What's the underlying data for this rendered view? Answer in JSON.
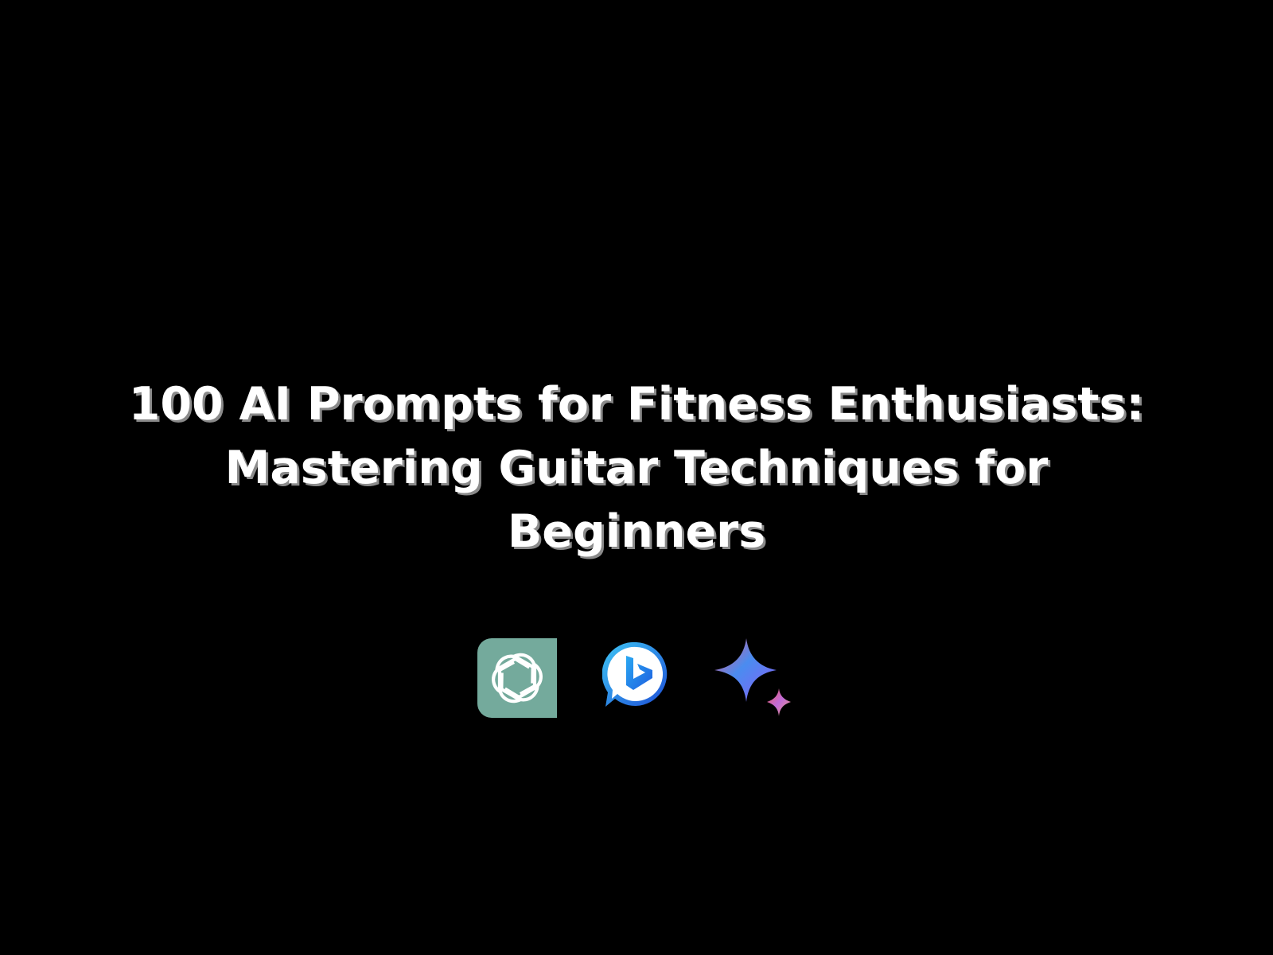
{
  "title": {
    "lines": [
      "100 AI Prompts for Fitness Enthusiasts:",
      "Mastering Guitar Techniques for",
      "Beginners"
    ]
  },
  "icons": [
    {
      "name": "chatgpt-logo-icon",
      "color": "#74aa9c"
    },
    {
      "name": "bing-chat-logo-icon",
      "color": "#1f6fe5"
    },
    {
      "name": "gemini-sparkle-icon",
      "color": "#4a8cf0"
    }
  ],
  "colors": {
    "background": "#000000",
    "title_text": "#ffffff",
    "title_shadow": "#8a8a8a"
  }
}
